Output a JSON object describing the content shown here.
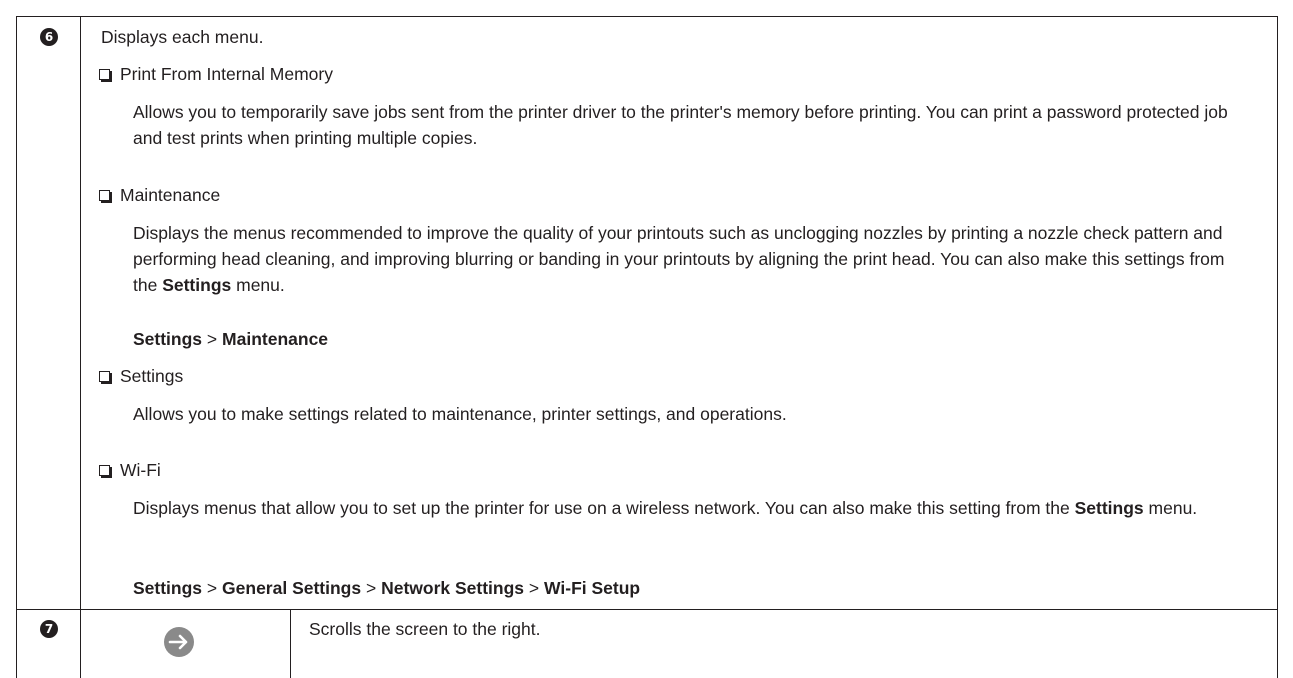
{
  "rows": [
    {
      "number": "6",
      "intro": "Displays each menu.",
      "items": [
        {
          "title": "Print From Internal Memory",
          "description": "Allows you to temporarily save jobs sent from the printer driver to the printer's memory before printing. You can print a password protected job and test prints when printing multiple copies."
        },
        {
          "title": "Maintenance",
          "description": "Displays the menus recommended to improve the quality of your printouts such as unclogging nozzles by printing a nozzle check pattern and performing head cleaning, and improving blurring or banding in your printouts by aligning the print head. You can also make this settings from the",
          "bold_word": "Settings",
          "description_end": "menu.",
          "path": [
            "Settings",
            "Maintenance"
          ]
        },
        {
          "title": "Settings",
          "description": "Allows you to make settings related to maintenance, printer settings, and operations."
        },
        {
          "title": "Wi-Fi",
          "description": "Displays menus that allow you to set up the printer for use on a wireless network. You can also make this setting from the",
          "bold_word": "Settings",
          "description_end": "menu.",
          "path": [
            "Settings",
            "General Settings",
            "Network Settings",
            "Wi-Fi Setup"
          ]
        }
      ]
    },
    {
      "number": "7",
      "icon": "right-arrow-circle-icon",
      "description": "Scrolls the screen to the right."
    }
  ],
  "separator": ">",
  "colors": {
    "text": "#231f20",
    "icon": "#8a8a8a"
  }
}
